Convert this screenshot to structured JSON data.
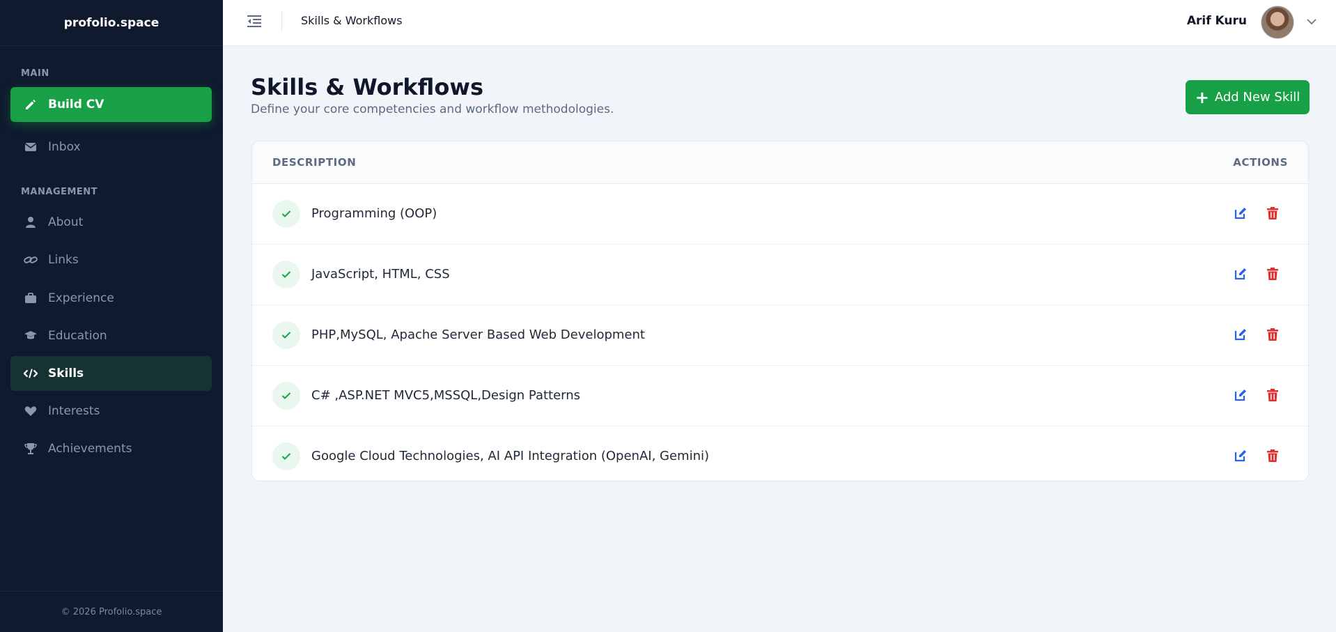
{
  "brand": "profolio.space",
  "sidebar": {
    "main_label": "MAIN",
    "management_label": "MANAGEMENT",
    "items": [
      {
        "label": "Build CV",
        "icon": "pencil-icon"
      },
      {
        "label": "Inbox",
        "icon": "envelope-icon"
      },
      {
        "label": "About",
        "icon": "user-icon"
      },
      {
        "label": "Links",
        "icon": "link-icon"
      },
      {
        "label": "Experience",
        "icon": "briefcase-icon"
      },
      {
        "label": "Education",
        "icon": "graduation-cap-icon"
      },
      {
        "label": "Skills",
        "icon": "code-icon"
      },
      {
        "label": "Interests",
        "icon": "heart-icon"
      },
      {
        "label": "Achievements",
        "icon": "trophy-icon"
      }
    ],
    "footer": "© 2026 Profolio.space"
  },
  "header": {
    "title": "Skills & Workflows",
    "user_name": "Arif Kuru"
  },
  "main": {
    "title": "Skills & Workflows",
    "subtitle": "Define your core competencies and workflow methodologies.",
    "add_button": "Add New Skill",
    "table": {
      "col_description": "DESCRIPTION",
      "col_actions": "ACTIONS",
      "rows": [
        {
          "description": "Programming (OOP)"
        },
        {
          "description": "JavaScript, HTML, CSS"
        },
        {
          "description": "PHP,MySQL, Apache Server Based Web Development"
        },
        {
          "description": "C# ,ASP.NET MVC5,MSSQL,Design Patterns"
        },
        {
          "description": "Google Cloud Technologies, AI API Integration (OpenAI, Gemini)"
        }
      ]
    }
  },
  "colors": {
    "sidebar_bg": "#0f1a2e",
    "accent_green": "#17a045",
    "edit_blue": "#2563eb",
    "delete_red": "#e03131"
  }
}
